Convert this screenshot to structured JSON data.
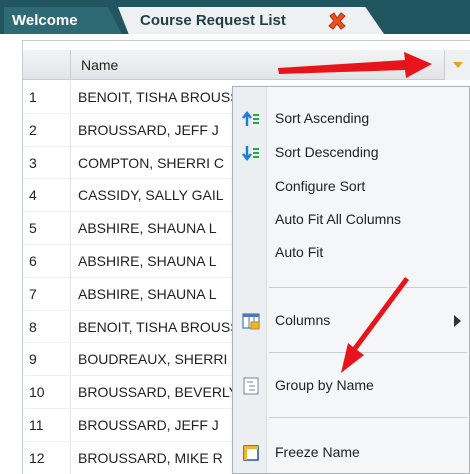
{
  "tabs": [
    {
      "label": "Welcome"
    },
    {
      "label": "Course Request List"
    }
  ],
  "grid": {
    "column_header": "Name",
    "rows": [
      {
        "num": "1",
        "name": "BENOIT, TISHA BROUSSARD"
      },
      {
        "num": "2",
        "name": "BROUSSARD, JEFF J"
      },
      {
        "num": "3",
        "name": "COMPTON, SHERRI C"
      },
      {
        "num": "4",
        "name": "CASSIDY, SALLY GAIL"
      },
      {
        "num": "5",
        "name": "ABSHIRE, SHAUNA L"
      },
      {
        "num": "6",
        "name": "ABSHIRE, SHAUNA L"
      },
      {
        "num": "7",
        "name": "ABSHIRE, SHAUNA L"
      },
      {
        "num": "8",
        "name": "BENOIT, TISHA BROUSSARD"
      },
      {
        "num": "9",
        "name": "BOUDREAUX, SHERRI"
      },
      {
        "num": "10",
        "name": "BROUSSARD, BEVERLY"
      },
      {
        "num": "11",
        "name": "BROUSSARD, JEFF J"
      },
      {
        "num": "12",
        "name": "BROUSSARD, MIKE R"
      }
    ]
  },
  "menu": {
    "sort_ascending": "Sort Ascending",
    "sort_descending": "Sort Descending",
    "configure_sort": "Configure Sort",
    "auto_fit_all": "Auto Fit All Columns",
    "auto_fit": "Auto Fit",
    "columns": "Columns",
    "group_by_name": "Group by Name",
    "freeze_name": "Freeze Name"
  },
  "colors": {
    "tabbar": "#21555f",
    "annotation_arrow": "#e8141b",
    "menu_trigger": "#e8a21a"
  }
}
